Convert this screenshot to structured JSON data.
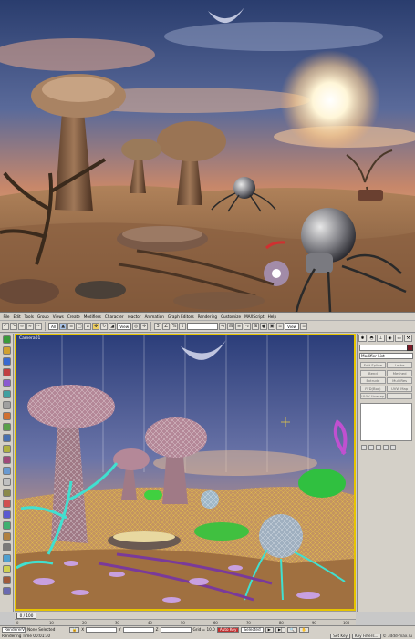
{
  "menu": {
    "items": [
      "File",
      "Edit",
      "Tools",
      "Group",
      "Views",
      "Create",
      "Modifiers",
      "Character",
      "reactor",
      "Animation",
      "Graph Editors",
      "Rendering",
      "Customize",
      "MAXScript",
      "Help"
    ]
  },
  "toolbar": {
    "selection_filter": "All",
    "reference_coord": "View",
    "named_selection": "",
    "viewport_dropdown": "View"
  },
  "viewport": {
    "label": "Camera01"
  },
  "command_panel": {
    "object_name": "",
    "modifier_list": "Modifier List",
    "buttons": [
      "Edit Spline",
      "Lathe",
      "Bend",
      "Meshed",
      "Extrude",
      "MultiRes",
      "FFD(Box)",
      "UVW Map",
      "UVW Unwrap",
      ""
    ],
    "swatch_color": "#7a1a26"
  },
  "timeline": {
    "frame_label": "0 / 100",
    "ticks": [
      "0",
      "10",
      "20",
      "30",
      "40",
      "50",
      "60",
      "70",
      "80",
      "90",
      "100"
    ]
  },
  "status": {
    "script_label": "RendererV",
    "selection_label": "None Selected",
    "prompt": "Rendering Time 00:01:30",
    "x_label": "X",
    "y_label": "Y",
    "z_label": "Z",
    "grid_label": "Grid = 10.0",
    "auto_key": "Auto Key",
    "selected_dropdown": "Selected",
    "set_key": "Set Key",
    "key_filters": "Key Filters...",
    "watermark": "© 3ddd-max.ru"
  }
}
